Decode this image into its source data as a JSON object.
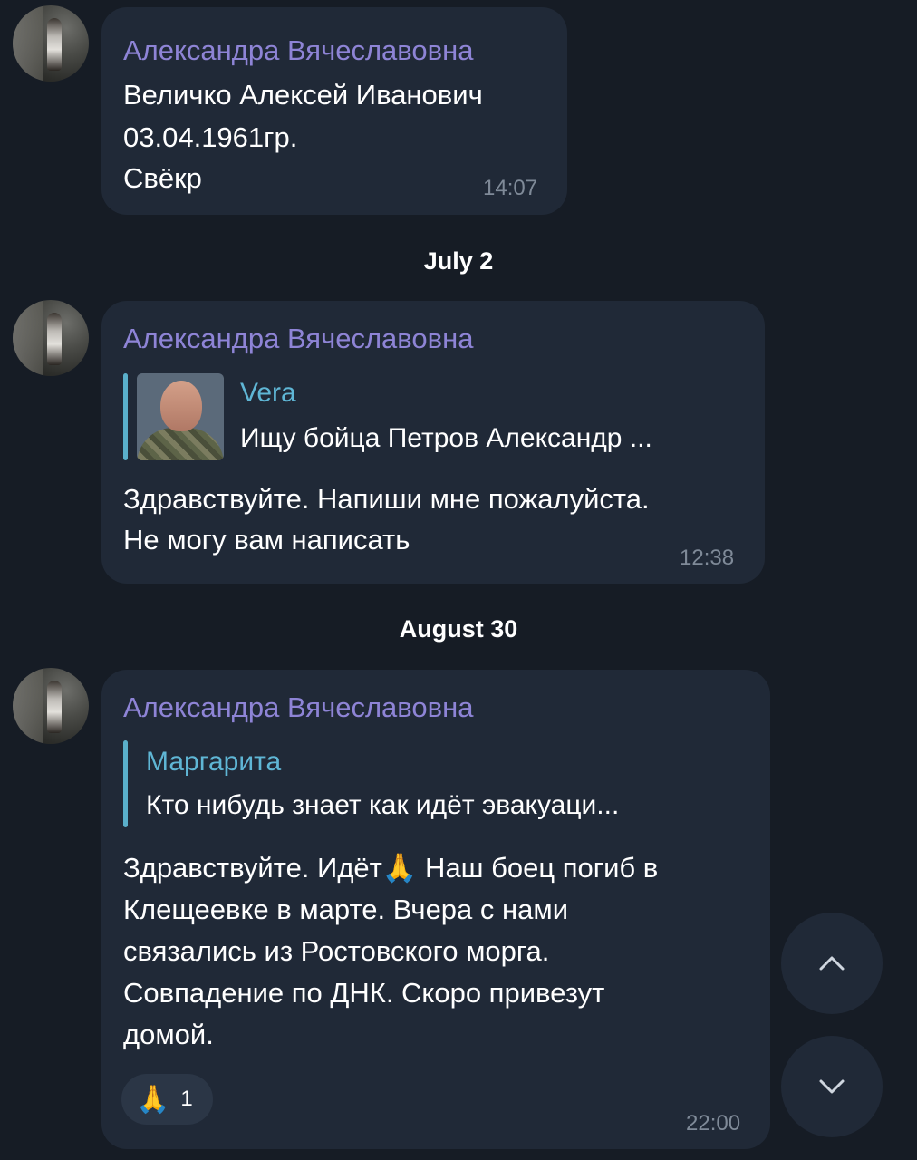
{
  "messages": [
    {
      "sender": "Александра Вячеславовна",
      "lines": [
        "Величко Алексей Иванович",
        "03.04.1961гр.",
        "Свёкр"
      ],
      "time": "14:07"
    },
    {
      "sender": "Александра Вячеславовна",
      "reply": {
        "name": "Vera",
        "text": "Ищу бойца Петров Александр ..."
      },
      "lines": [
        "Здравствуйте. Напиши мне пожалуйста.",
        "Не могу вам написать"
      ],
      "time": "12:38"
    },
    {
      "sender": "Александра Вячеславовна",
      "reply": {
        "name": "Маргарита",
        "text": "Кто нибудь знает как идёт эвакуаци..."
      },
      "lines": [
        "Здравствуйте. Идёт🙏 Наш боец погиб в",
        "Клещеевке в марте. Вчера с нами",
        "связались из Ростовского морга.",
        "Совпадение по ДНК. Скоро привезут",
        "домой."
      ],
      "reaction": {
        "emoji": "🙏",
        "count": "1"
      },
      "time": "22:00"
    }
  ],
  "date_separators": [
    "July 2",
    "August 30"
  ],
  "icons": {
    "scroll_up": "chevron-up-icon",
    "scroll_down": "chevron-down-icon"
  },
  "colors": {
    "background": "#161c25",
    "bubble": "#202937",
    "sender_name": "#8e84d6",
    "reply_name": "#5fb6d5",
    "reply_bar": "#5aafca",
    "time": "#7f8a98"
  }
}
